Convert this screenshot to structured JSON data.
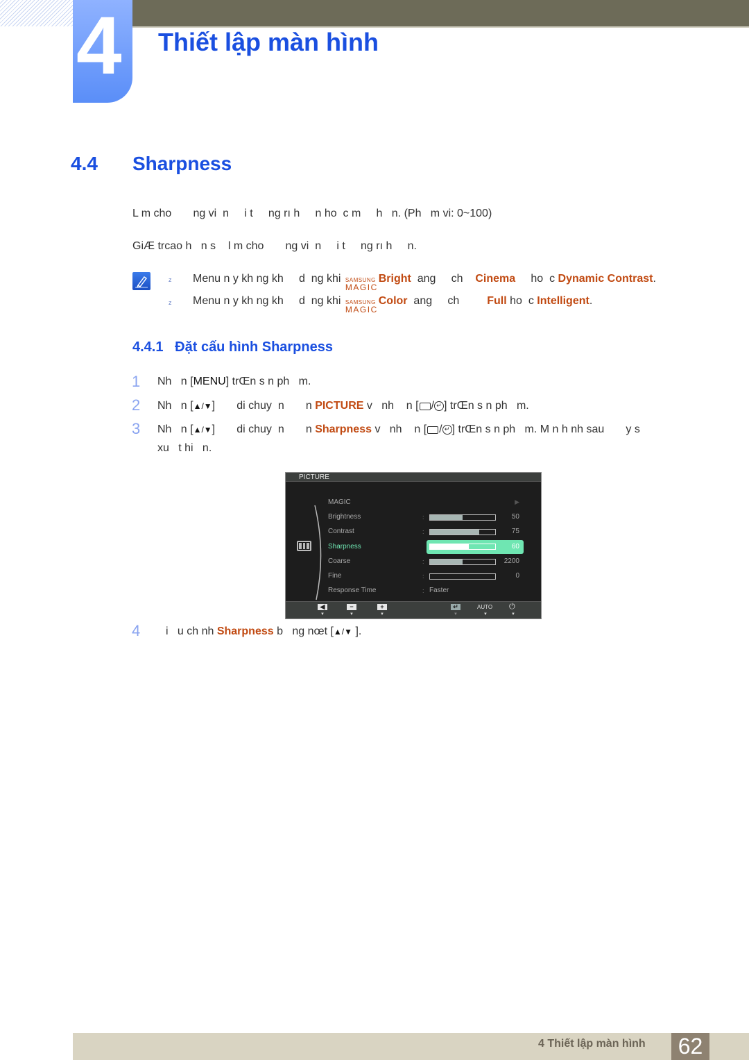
{
  "header": {
    "chapter_number": "4",
    "chapter_title": "Thiết lập màn hình"
  },
  "section": {
    "number": "4.4",
    "title": "Sharpness",
    "para1": "L m cho       ng vi  n     i t     ng rı h     n ho  c m     h   n. (Ph   m vi: 0~100)",
    "para2": "GiÆ trcao h   n s    l m cho       ng vi  n     i t     ng rı h     n."
  },
  "notes": [
    {
      "bullet": "z",
      "prefix": "Menu n y kh ng kh     d  ng khi ",
      "magic_top": "SAMSUNG",
      "magic_bottom": "MAGIC",
      "magic_word": "Bright",
      "middle": "  ang     ch    ",
      "hl1": "Cinema",
      "between": "     ho  c ",
      "hl2": "Dynamic Contrast",
      "end": "."
    },
    {
      "bullet": "z",
      "prefix": "Menu n y kh ng kh     d  ng khi ",
      "magic_top": "SAMSUNG",
      "magic_bottom": "MAGIC",
      "magic_word": "Color",
      "middle": "  ang     ch         ",
      "hl1": "Full",
      "between": " ho  c ",
      "hl2": "Intelligent",
      "end": "."
    }
  ],
  "subsection": {
    "number": "4.4.1",
    "title": "Đặt cấu hình Sharpness"
  },
  "steps": [
    {
      "num": "1",
      "pre": "Nh   n [",
      "key": "MENU",
      "post": "] trŒn s n ph   m."
    },
    {
      "num": "2",
      "pre": "Nh   n [",
      "key": "▲/▼",
      "mid": "]       di chuy  n       n ",
      "hl": "PICTURE",
      "mid2": " v   nh    n [",
      "post": "] trŒn s n ph   m."
    },
    {
      "num": "3",
      "pre": "Nh   n [",
      "key": "▲/▼",
      "mid": "]       di chuy  n       n ",
      "hl": "Sharpness",
      "mid2": " v   nh    n [",
      "post": "] trŒn s n ph   m. M n h nh sau       y s",
      "line2": "xu   t hi   n."
    },
    {
      "num": "4",
      "pre": "i   u ch nh ",
      "hl": "Sharpness",
      "mid": " b   ng nœt [",
      "key": "▲/▼",
      "post": " ]."
    }
  ],
  "osd": {
    "title": "PICTURE",
    "items": [
      {
        "label": "MAGIC",
        "type": "arrow",
        "value": "▶"
      },
      {
        "label": "Brightness",
        "type": "bar",
        "fill": 0.5,
        "value": "50"
      },
      {
        "label": "Contrast",
        "type": "bar",
        "fill": 0.75,
        "value": "75"
      },
      {
        "label": "Sharpness",
        "type": "bar",
        "fill": 0.6,
        "value": "60",
        "active": true
      },
      {
        "label": "Coarse",
        "type": "bar",
        "fill": 0.5,
        "value": "2200"
      },
      {
        "label": "Fine",
        "type": "bar",
        "fill": 0.0,
        "value": "0"
      },
      {
        "label": "Response Time",
        "type": "text",
        "value": "Faster"
      }
    ],
    "colon": ":",
    "buttons": {
      "left": "◀",
      "minus": "−",
      "plus": "+",
      "enter": "↵",
      "auto": "AUTO",
      "power": "⏻",
      "tri": "▼"
    }
  },
  "footer": {
    "chapter_label": "4 Thiết lập màn hình",
    "page_number": "62"
  }
}
